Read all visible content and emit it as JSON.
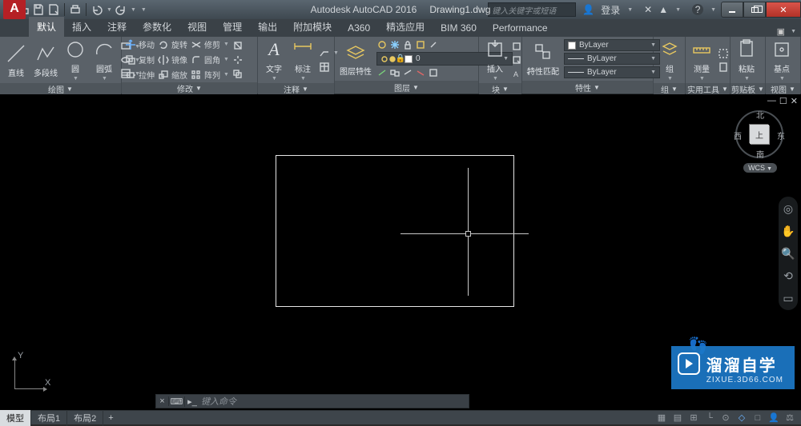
{
  "title": {
    "app": "Autodesk AutoCAD 2016",
    "file": "Drawing1.dwg"
  },
  "search": {
    "placeholder": "键入关键字或短语"
  },
  "login": {
    "label": "登录"
  },
  "tabs": [
    "默认",
    "插入",
    "注释",
    "参数化",
    "视图",
    "管理",
    "输出",
    "附加模块",
    "A360",
    "精选应用",
    "BIM 360",
    "Performance"
  ],
  "active_tab": 0,
  "panels": {
    "draw": {
      "label": "绘图",
      "line": "直线",
      "polyline": "多段线",
      "circle": "圆",
      "arc": "圆弧"
    },
    "modify": {
      "label": "修改",
      "move": "移动",
      "rotate": "旋转",
      "trim": "修剪",
      "copy": "复制",
      "mirror": "镜像",
      "fillet": "圆角",
      "stretch": "拉伸",
      "scale": "缩放",
      "array": "阵列"
    },
    "annot": {
      "label": "注释",
      "text": "文字",
      "dim": "标注",
      "table": "表格"
    },
    "layers": {
      "label": "图层",
      "props": "图层特性",
      "combo_value": "0",
      "make_current": "置为当前",
      "match": "匹配"
    },
    "block": {
      "label": "块",
      "insert": "插入",
      "create": "创建",
      "edit": "编辑"
    },
    "props": {
      "label": "特性",
      "match": "特性匹配",
      "color": "ByLayer",
      "ltype": "ByLayer",
      "lweight": "ByLayer"
    },
    "group": {
      "label": "组",
      "group": "组"
    },
    "utils": {
      "label": "实用工具",
      "measure": "测量"
    },
    "clip": {
      "label": "剪贴板",
      "paste": "粘贴"
    },
    "view": {
      "label": "视图",
      "base": "基点"
    }
  },
  "viewcube": {
    "top": "上",
    "n": "北",
    "s": "南",
    "e": "东",
    "w": "西",
    "wcs": "WCS"
  },
  "ucs": {
    "x": "X",
    "y": "Y"
  },
  "cmdline": {
    "placeholder": "键入命令"
  },
  "bottom_tabs": [
    "模型",
    "布局1",
    "布局2"
  ],
  "active_bottom_tab": 0,
  "watermark": {
    "name": "溜溜自学",
    "url": "ZIXUE.3D66.COM"
  },
  "doc_controls": {
    "min": "—",
    "max": "☐",
    "close": "✕"
  }
}
